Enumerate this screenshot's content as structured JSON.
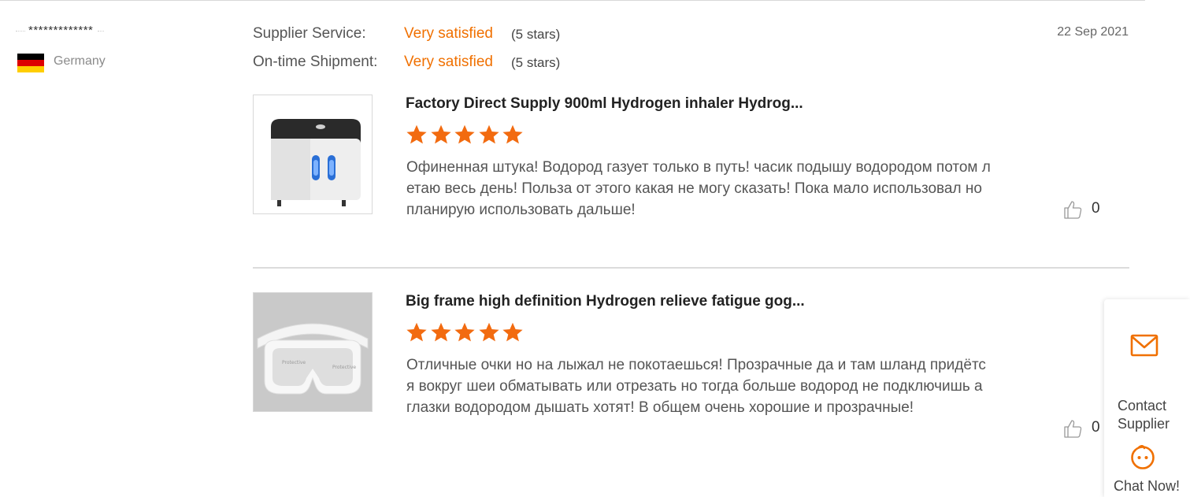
{
  "reviewer": {
    "name": "*************",
    "country": "Germany",
    "flag_icon": "germany-flag-icon"
  },
  "ratings": [
    {
      "label": "Supplier Service:",
      "value": "Very satisfied",
      "stars_text": "(5 stars)"
    },
    {
      "label": "On-time Shipment:",
      "value": "Very satisfied",
      "stars_text": "(5 stars)"
    }
  ],
  "date": "22 Sep 2021",
  "reviews": [
    {
      "product_title": "Factory Direct Supply 900ml Hydrogen inhaler Hydrog...",
      "rating": 5,
      "text": "Офиненная штука! Водород газует только в путь! часик подышу водородом потом летаю весь день! Польза от этого какая не могу сказать! Пока мало использовал но планирую использовать дальше!",
      "likes": "0",
      "image_icon": "hydrogen-inhaler-image"
    },
    {
      "product_title": "Big frame high definition Hydrogen relieve fatigue gog...",
      "rating": 5,
      "text": "Отличные очки но на лыжал не покотаешься! Прозрачные да и там шланд придётся вокруг шеи обматывать или отрезать но тогда больше водород не подключишь а глазки водородом дышать хотят! В общем очень хорошие и прозрачные!",
      "likes": "0",
      "image_icon": "goggles-image"
    }
  ],
  "side_panel": {
    "contact_label": "Contact Supplier",
    "chat_label": "Chat Now!",
    "contact_icon": "envelope-icon",
    "chat_icon": "chat-face-icon"
  },
  "colors": {
    "accent": "#f07000",
    "star": "#f26b10",
    "divider": "#dcdcdc"
  }
}
